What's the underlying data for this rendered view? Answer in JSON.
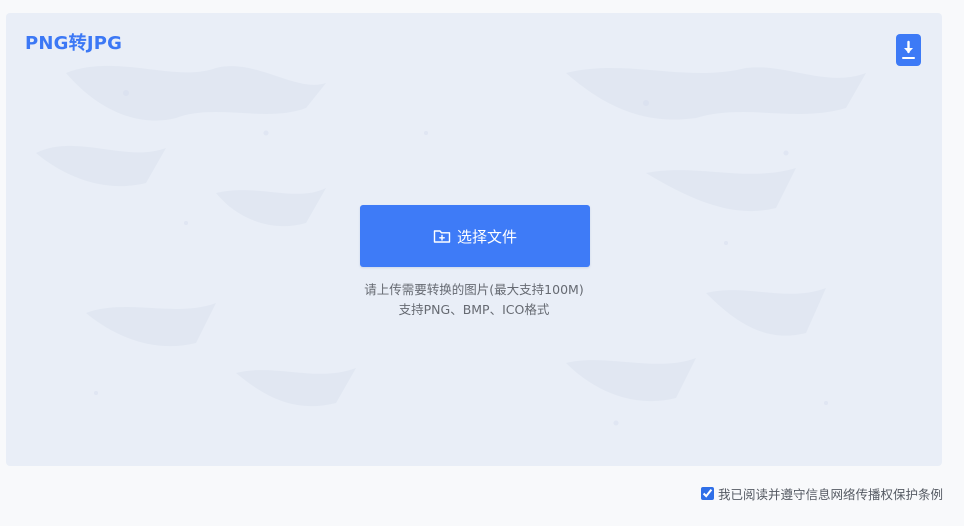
{
  "app": {
    "title": "PNG转JPG"
  },
  "toolbar": {
    "download_icon": "download-icon"
  },
  "upload": {
    "button_label": "选择文件",
    "button_icon": "folder-add-icon",
    "hint_line1": "请上传需要转换的图片(最大支持100M)",
    "hint_line2": "支持PNG、BMP、ICO格式"
  },
  "footer": {
    "agreement_checked": true,
    "agreement_label": "我已阅读并遵守信息网络传播权保护条例"
  },
  "colors": {
    "accent": "#3e7bf7",
    "panel_bg": "#e9eef7"
  }
}
